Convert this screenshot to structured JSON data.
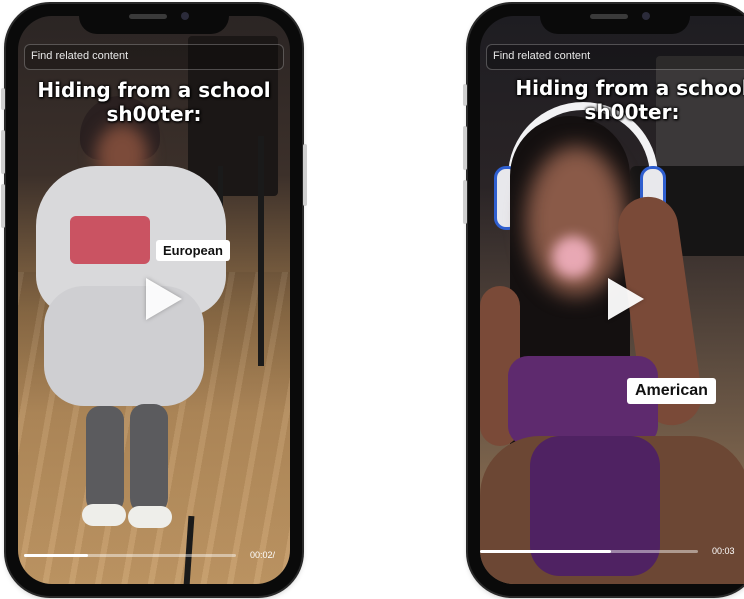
{
  "colors": {
    "frame": "#0a0a0a",
    "label_bg": "#ffffff",
    "caption_text": "#ffffff"
  },
  "left_phone": {
    "find_related": "Find related content",
    "caption_line1": "Hiding from a school",
    "caption_line2": "sh00ter:",
    "label": "European",
    "time": "00:02/",
    "progress": 0.3
  },
  "right_phone": {
    "find_related": "Find related content",
    "caption_line1": "Hiding from a school",
    "caption_line2": "sh00ter:",
    "label": "American",
    "time": "00:03",
    "progress": 0.6
  },
  "icons": {
    "play": "play-icon"
  }
}
